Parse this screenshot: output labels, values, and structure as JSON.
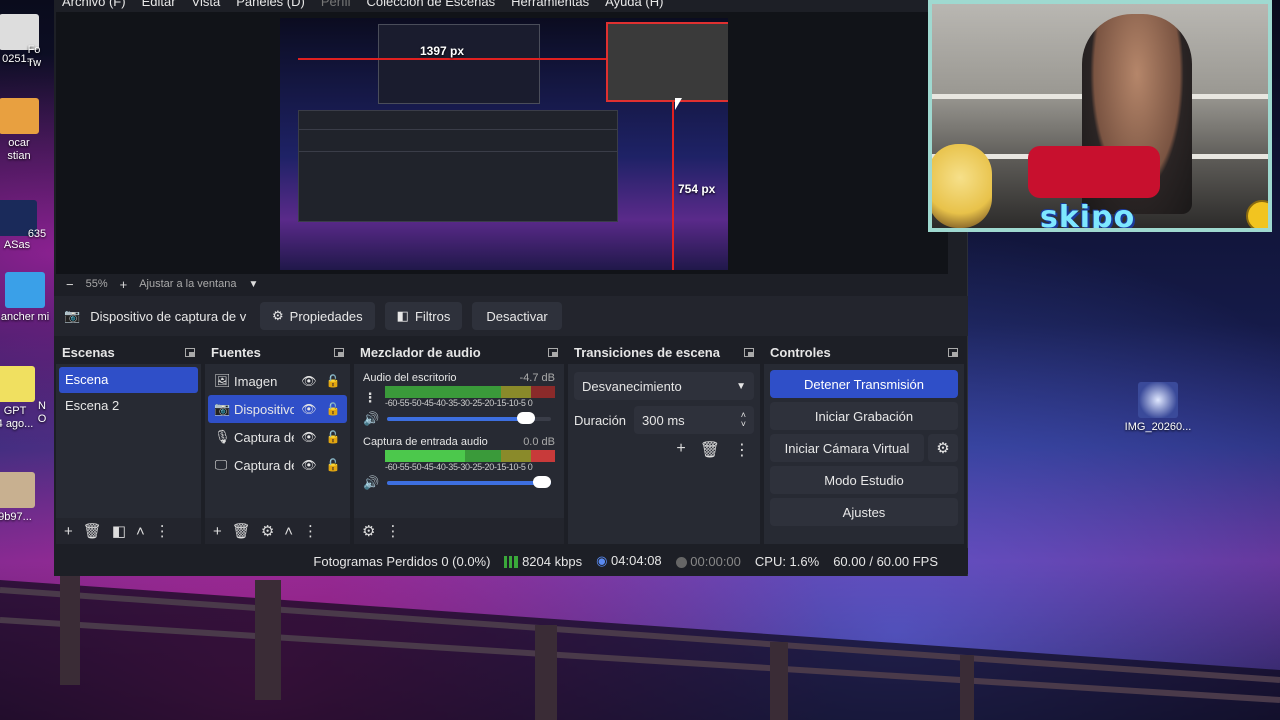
{
  "menu": {
    "items": [
      "Archivo (F)",
      "Editar",
      "Vista",
      "Paneles (D)",
      "Perfil",
      "Colección de Escenas",
      "Herramientas",
      "Ayuda (H)"
    ]
  },
  "preview": {
    "width_label": "1397 px",
    "height_label": "754 px",
    "zoom": "55%",
    "fit_label": "Ajustar a la ventana"
  },
  "context": {
    "source_name": "Dispositivo de captura de v",
    "properties": "Propiedades",
    "filters": "Filtros",
    "deactivate": "Desactivar"
  },
  "scenes": {
    "title": "Escenas",
    "items": [
      "Escena",
      "Escena 2"
    ]
  },
  "sources": {
    "title": "Fuentes",
    "items": [
      "Imagen",
      "Dispositivo",
      "Captura de",
      "Captura de"
    ]
  },
  "mixer": {
    "title": "Mezclador de audio",
    "channels": [
      {
        "name": "Audio del escritorio",
        "db": "-4.7 dB",
        "volume": 0.9
      },
      {
        "name": "Captura de entrada audio",
        "db": "0.0 dB",
        "volume": 1.0
      }
    ],
    "scale": "-60-55-50-45-40-35-30-25-20-15-10-5  0"
  },
  "transitions": {
    "title": "Transiciones de escena",
    "selected": "Desvanecimiento",
    "duration_label": "Duración",
    "duration_value": "300 ms"
  },
  "controls": {
    "title": "Controles",
    "stop_stream": "Detener Transmisión",
    "start_record": "Iniciar Grabación",
    "start_vcam": "Iniciar Cámara Virtual",
    "studio_mode": "Modo Estudio",
    "settings": "Ajustes"
  },
  "status": {
    "dropped": "Fotogramas Perdidos 0 (0.0%)",
    "bitrate": "8204 kbps",
    "stream_time": "04:04:08",
    "rec_time": "00:00:00",
    "cpu": "CPU: 1.6%",
    "fps": "60.00 / 60.00 FPS"
  },
  "desktop": {
    "icons": [
      "0251...",
      "Fo\nTw",
      "ocar\nstian",
      "ASas",
      "635",
      "ancher mi",
      "GPT\n4 ago...",
      "N\nO",
      "9b97...",
      "IMG_20260..."
    ]
  },
  "overlay": {
    "brand": "skipo"
  },
  "colors": {
    "accent": "#2f4fc8",
    "panel": "#272a33",
    "window": "#1d1f26"
  }
}
